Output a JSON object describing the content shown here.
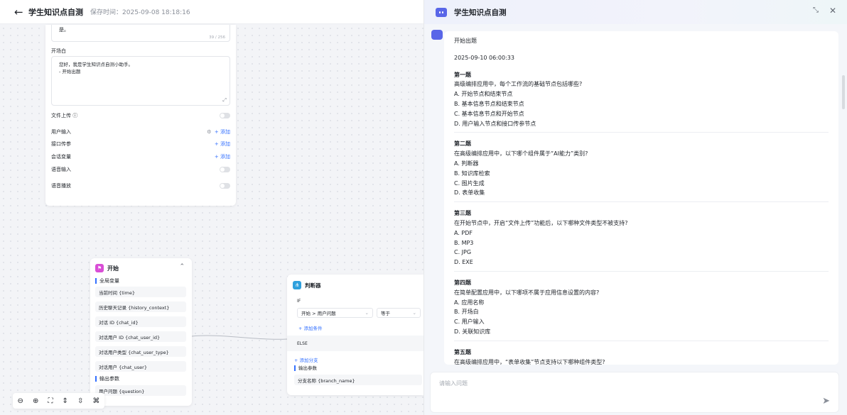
{
  "header": {
    "title": "学生知识点自测",
    "saved_label": "保存时间：",
    "saved_time": "2025-09-08 18:18:16"
  },
  "settings_card": {
    "top_text": "是。",
    "counter": "39 / 256",
    "opening_label": "开场白",
    "opening_line1": "您好，我是学生知识点自测小助手。",
    "opening_line2": "- 开始出题",
    "file_upload": "文件上传",
    "user_input": "用户输入",
    "api_param": "接口传参",
    "session_var": "会话变量",
    "voice_input": "语音输入",
    "voice_play": "语音播放",
    "add": "+ 添加"
  },
  "start_node": {
    "title": "开始",
    "global_vars": "全局变量",
    "vars": [
      "当前时间 {time}",
      "历史聊天记录 {history_context}",
      "对话 ID {chat_id}",
      "对话用户 ID {chat_user_id}",
      "对话用户类型 {chat_user_type}",
      "对话用户 {chat_user}"
    ],
    "output_label": "输出参数",
    "output": "用户问题 {question}"
  },
  "judge_node": {
    "title": "判断器",
    "if": "IF",
    "field": "开始 > 用户问题",
    "op": "等于",
    "add_cond": "+ 添加条件",
    "else": "ELSE",
    "add_branch": "+ 添加分支",
    "output_label": "输出参数",
    "output": "分支名称 {branch_name}"
  },
  "chat": {
    "title": "学生知识点自测",
    "start": "开始出题",
    "time": "2025-09-10 06:00:33",
    "questions": [
      {
        "h": "第一题",
        "q": "高级编排应用中，每个工作流的基础节点包括哪些?",
        "o": [
          "A. 开始节点和结束节点",
          "B. 基本信息节点和结束节点",
          "C. 基本信息节点和开始节点",
          "D. 用户输入节点和接口传参节点"
        ]
      },
      {
        "h": "第二题",
        "q": "在高级编排应用中，以下哪个组件属于“AI能力”类别?",
        "o": [
          "A. 判断器",
          "B. 知识库检索",
          "C. 图片生成",
          "D. 表单收集"
        ]
      },
      {
        "h": "第三题",
        "q": "在开始节点中，开启“文件上传”功能后，以下哪种文件类型不被支持?",
        "o": [
          "A. PDF",
          "B. MP3",
          "C. JPG",
          "D. EXE"
        ]
      },
      {
        "h": "第四题",
        "q": "在简单配置应用中，以下哪项不属于应用信息设置的内容?",
        "o": [
          "A. 应用名称",
          "B. 开场白",
          "C. 用户输入",
          "D. 关联知识库"
        ]
      },
      {
        "h": "第五题",
        "q": "在高级编排应用中，“表单收集”节点支持以下哪种组件类型?",
        "o": []
      }
    ],
    "input_placeholder": "请输入问题"
  }
}
